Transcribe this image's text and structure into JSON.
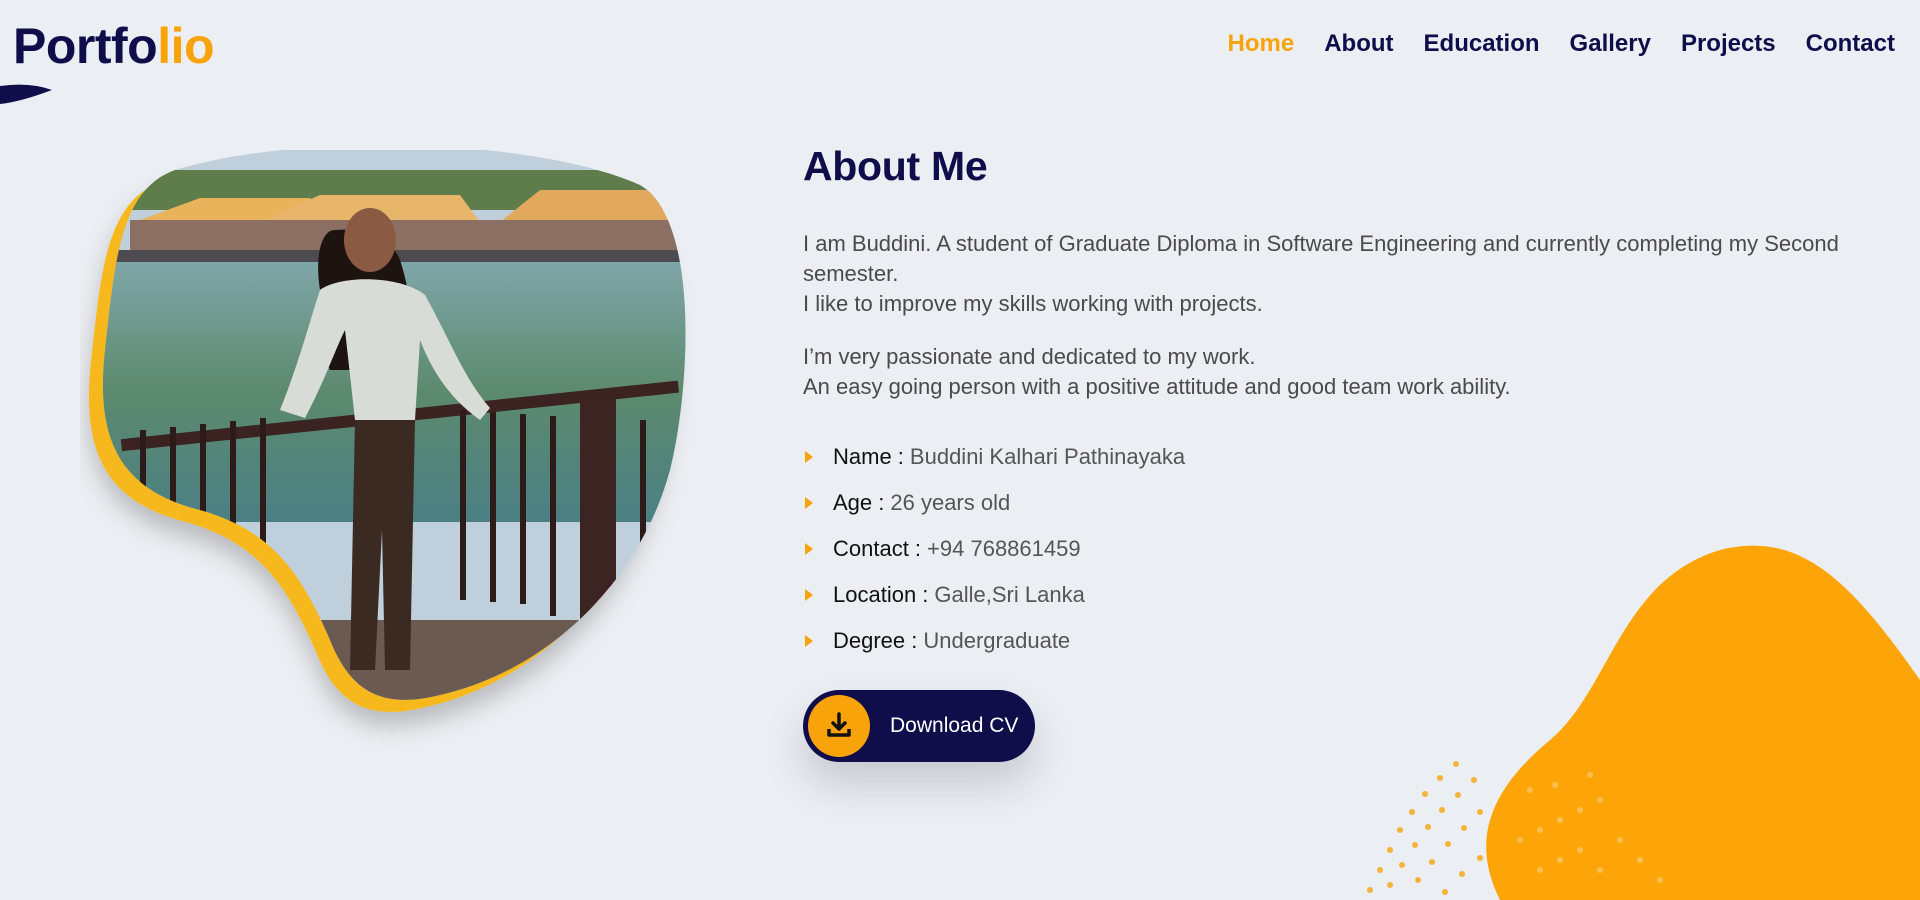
{
  "brand": {
    "part1": "Portfo",
    "part2": "lio"
  },
  "nav": [
    {
      "label": "Home",
      "active": true
    },
    {
      "label": "About",
      "active": false
    },
    {
      "label": "Education",
      "active": false
    },
    {
      "label": "Gallery",
      "active": false
    },
    {
      "label": "Projects",
      "active": false
    },
    {
      "label": "Contact",
      "active": false
    }
  ],
  "about": {
    "title": "About Me",
    "paragraph1": [
      "I am Buddini. A student of Graduate Diploma in Software Engineering and currently completing my Second",
      "semester.",
      "I like to improve my skills working with projects."
    ],
    "paragraph2": [
      "I’m very passionate and dedicated to my work.",
      "An easy going person with a positive attitude and good team work ability."
    ],
    "details": [
      {
        "key": "Name :",
        "value": "Buddini Kalhari Pathinayaka"
      },
      {
        "key": "Age :",
        "value": "26 years old"
      },
      {
        "key": "Contact :",
        "value": "+94 768861459"
      },
      {
        "key": "Location :",
        "value": "Galle,Sri Lanka"
      },
      {
        "key": "Degree :",
        "value": "Undergraduate"
      }
    ],
    "download_label": "Download CV"
  },
  "icons": {
    "download": "download-icon",
    "caret": "caret-right-icon"
  },
  "colors": {
    "navy": "#0f0d4a",
    "accent": "#f9a30a",
    "background": "#ebeef2"
  }
}
